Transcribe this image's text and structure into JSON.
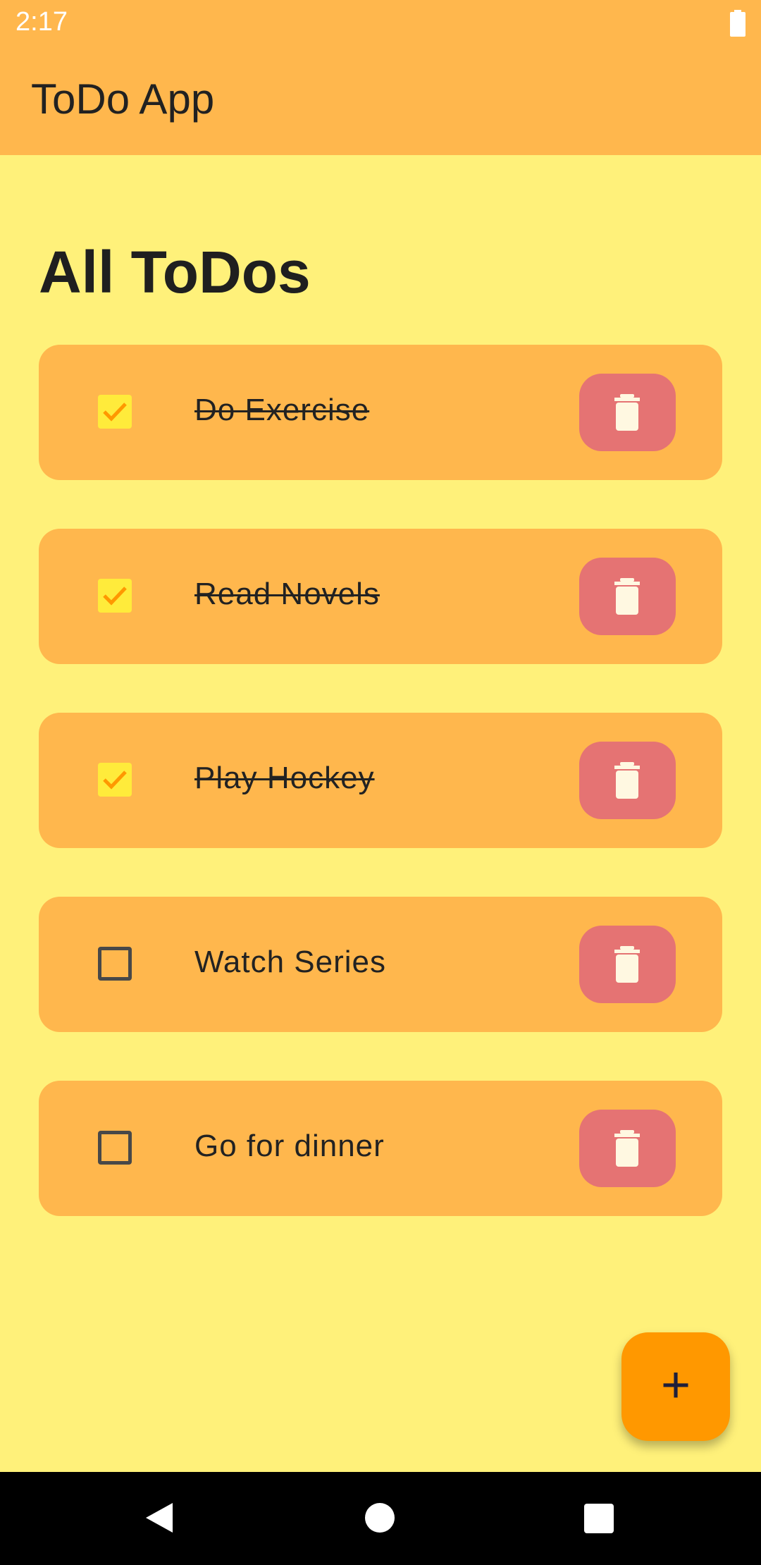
{
  "status_bar": {
    "time": "2:17",
    "icons": [
      "battery-icon"
    ]
  },
  "app_bar": {
    "title": "ToDo App"
  },
  "main": {
    "section_title": "All ToDos",
    "todos": [
      {
        "label": "Do Exercise",
        "done": true
      },
      {
        "label": "Read Novels",
        "done": true
      },
      {
        "label": "Play Hockey",
        "done": true
      },
      {
        "label": "Watch Series",
        "done": false
      },
      {
        "label": "Go for dinner",
        "done": false
      }
    ]
  },
  "fab": {
    "label": "+"
  },
  "nav_bar": {
    "icons": [
      "back-icon",
      "home-icon",
      "recents-icon"
    ]
  },
  "colors": {
    "background": "#FFF17A",
    "app_bar": "#FFB74D",
    "card": "#FFB74D",
    "delete_button": "#E57373",
    "checkbox_checked_fill": "#FFEB3B",
    "checkmark": "#FF9800",
    "fab": "#FF9800"
  }
}
